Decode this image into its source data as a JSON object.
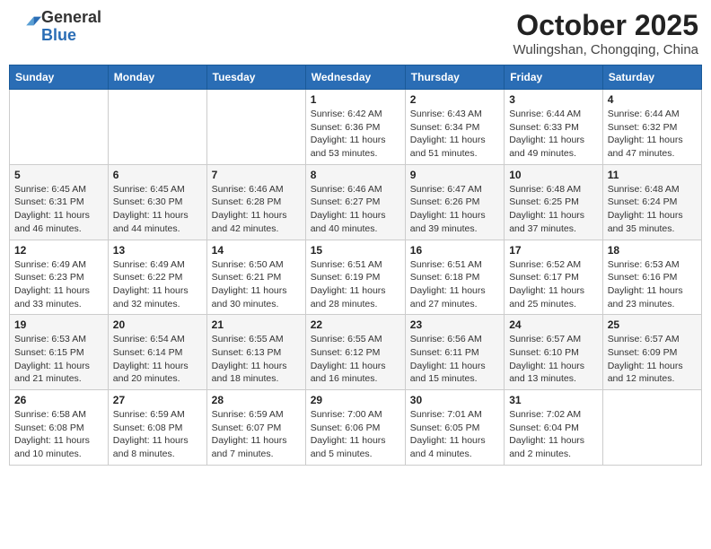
{
  "header": {
    "logo_general": "General",
    "logo_blue": "Blue",
    "month": "October 2025",
    "location": "Wulingshan, Chongqing, China"
  },
  "weekdays": [
    "Sunday",
    "Monday",
    "Tuesday",
    "Wednesday",
    "Thursday",
    "Friday",
    "Saturday"
  ],
  "weeks": [
    [
      {
        "day": "",
        "info": ""
      },
      {
        "day": "",
        "info": ""
      },
      {
        "day": "",
        "info": ""
      },
      {
        "day": "1",
        "info": "Sunrise: 6:42 AM\nSunset: 6:36 PM\nDaylight: 11 hours and 53 minutes."
      },
      {
        "day": "2",
        "info": "Sunrise: 6:43 AM\nSunset: 6:34 PM\nDaylight: 11 hours and 51 minutes."
      },
      {
        "day": "3",
        "info": "Sunrise: 6:44 AM\nSunset: 6:33 PM\nDaylight: 11 hours and 49 minutes."
      },
      {
        "day": "4",
        "info": "Sunrise: 6:44 AM\nSunset: 6:32 PM\nDaylight: 11 hours and 47 minutes."
      }
    ],
    [
      {
        "day": "5",
        "info": "Sunrise: 6:45 AM\nSunset: 6:31 PM\nDaylight: 11 hours and 46 minutes."
      },
      {
        "day": "6",
        "info": "Sunrise: 6:45 AM\nSunset: 6:30 PM\nDaylight: 11 hours and 44 minutes."
      },
      {
        "day": "7",
        "info": "Sunrise: 6:46 AM\nSunset: 6:28 PM\nDaylight: 11 hours and 42 minutes."
      },
      {
        "day": "8",
        "info": "Sunrise: 6:46 AM\nSunset: 6:27 PM\nDaylight: 11 hours and 40 minutes."
      },
      {
        "day": "9",
        "info": "Sunrise: 6:47 AM\nSunset: 6:26 PM\nDaylight: 11 hours and 39 minutes."
      },
      {
        "day": "10",
        "info": "Sunrise: 6:48 AM\nSunset: 6:25 PM\nDaylight: 11 hours and 37 minutes."
      },
      {
        "day": "11",
        "info": "Sunrise: 6:48 AM\nSunset: 6:24 PM\nDaylight: 11 hours and 35 minutes."
      }
    ],
    [
      {
        "day": "12",
        "info": "Sunrise: 6:49 AM\nSunset: 6:23 PM\nDaylight: 11 hours and 33 minutes."
      },
      {
        "day": "13",
        "info": "Sunrise: 6:49 AM\nSunset: 6:22 PM\nDaylight: 11 hours and 32 minutes."
      },
      {
        "day": "14",
        "info": "Sunrise: 6:50 AM\nSunset: 6:21 PM\nDaylight: 11 hours and 30 minutes."
      },
      {
        "day": "15",
        "info": "Sunrise: 6:51 AM\nSunset: 6:19 PM\nDaylight: 11 hours and 28 minutes."
      },
      {
        "day": "16",
        "info": "Sunrise: 6:51 AM\nSunset: 6:18 PM\nDaylight: 11 hours and 27 minutes."
      },
      {
        "day": "17",
        "info": "Sunrise: 6:52 AM\nSunset: 6:17 PM\nDaylight: 11 hours and 25 minutes."
      },
      {
        "day": "18",
        "info": "Sunrise: 6:53 AM\nSunset: 6:16 PM\nDaylight: 11 hours and 23 minutes."
      }
    ],
    [
      {
        "day": "19",
        "info": "Sunrise: 6:53 AM\nSunset: 6:15 PM\nDaylight: 11 hours and 21 minutes."
      },
      {
        "day": "20",
        "info": "Sunrise: 6:54 AM\nSunset: 6:14 PM\nDaylight: 11 hours and 20 minutes."
      },
      {
        "day": "21",
        "info": "Sunrise: 6:55 AM\nSunset: 6:13 PM\nDaylight: 11 hours and 18 minutes."
      },
      {
        "day": "22",
        "info": "Sunrise: 6:55 AM\nSunset: 6:12 PM\nDaylight: 11 hours and 16 minutes."
      },
      {
        "day": "23",
        "info": "Sunrise: 6:56 AM\nSunset: 6:11 PM\nDaylight: 11 hours and 15 minutes."
      },
      {
        "day": "24",
        "info": "Sunrise: 6:57 AM\nSunset: 6:10 PM\nDaylight: 11 hours and 13 minutes."
      },
      {
        "day": "25",
        "info": "Sunrise: 6:57 AM\nSunset: 6:09 PM\nDaylight: 11 hours and 12 minutes."
      }
    ],
    [
      {
        "day": "26",
        "info": "Sunrise: 6:58 AM\nSunset: 6:08 PM\nDaylight: 11 hours and 10 minutes."
      },
      {
        "day": "27",
        "info": "Sunrise: 6:59 AM\nSunset: 6:08 PM\nDaylight: 11 hours and 8 minutes."
      },
      {
        "day": "28",
        "info": "Sunrise: 6:59 AM\nSunset: 6:07 PM\nDaylight: 11 hours and 7 minutes."
      },
      {
        "day": "29",
        "info": "Sunrise: 7:00 AM\nSunset: 6:06 PM\nDaylight: 11 hours and 5 minutes."
      },
      {
        "day": "30",
        "info": "Sunrise: 7:01 AM\nSunset: 6:05 PM\nDaylight: 11 hours and 4 minutes."
      },
      {
        "day": "31",
        "info": "Sunrise: 7:02 AM\nSunset: 6:04 PM\nDaylight: 11 hours and 2 minutes."
      },
      {
        "day": "",
        "info": ""
      }
    ]
  ]
}
